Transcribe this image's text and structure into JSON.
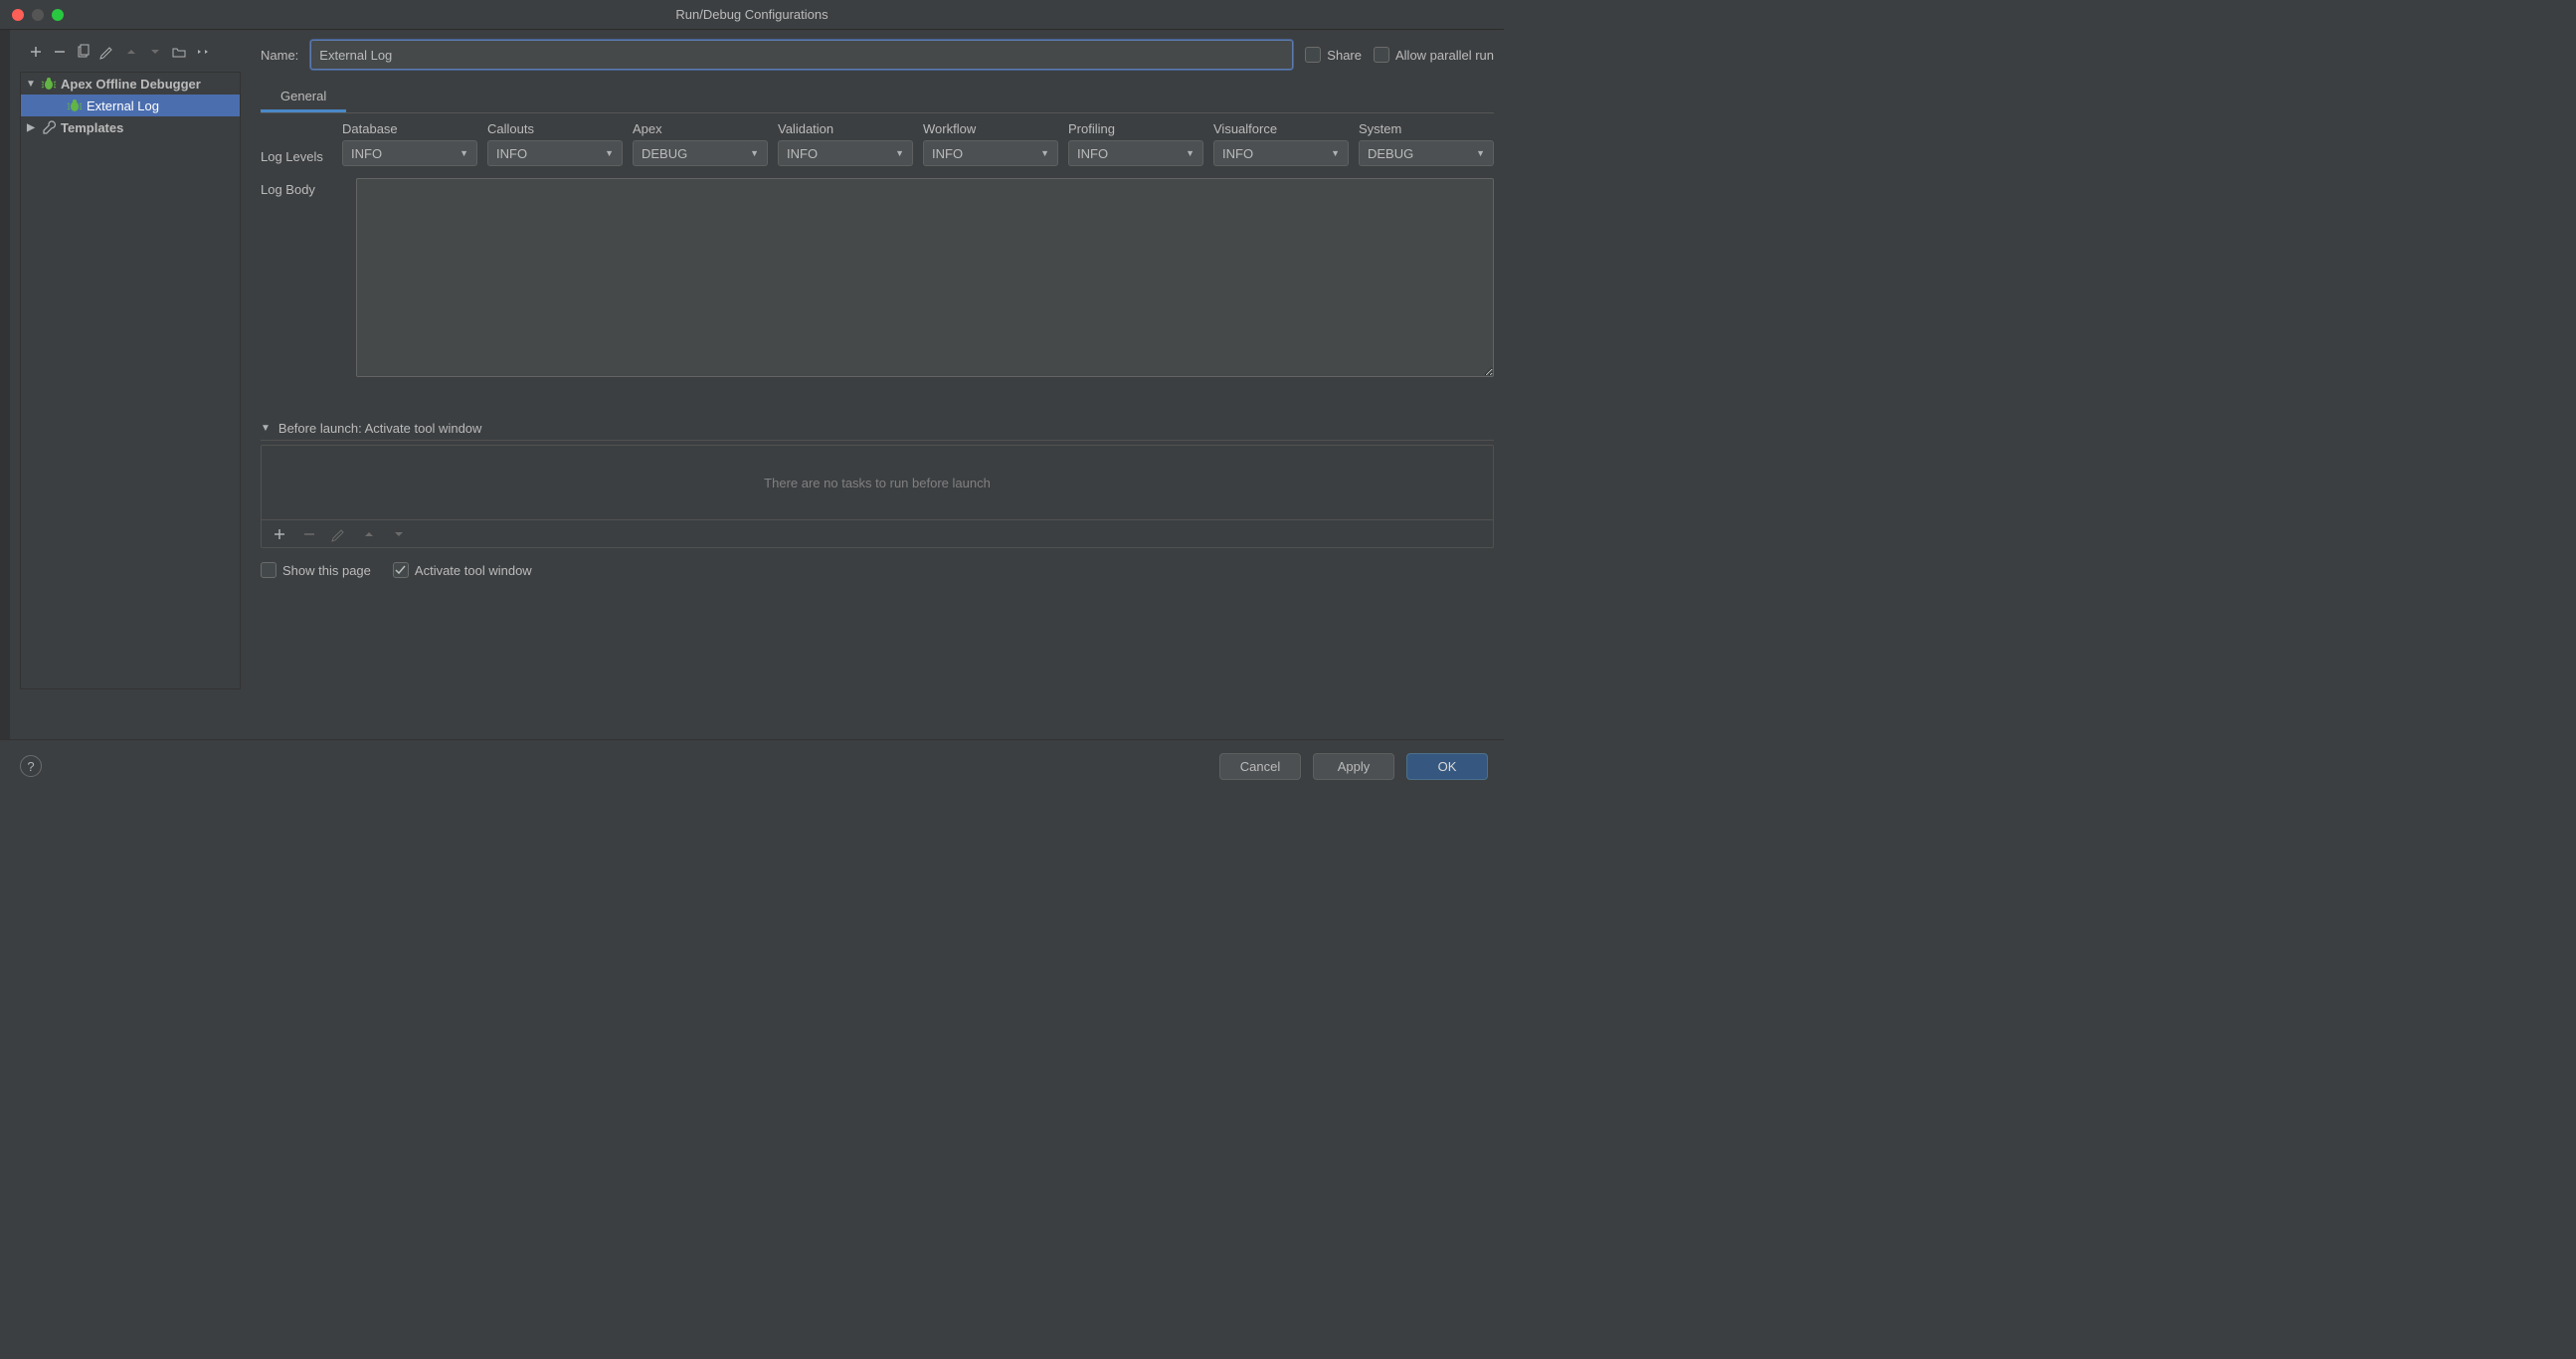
{
  "window": {
    "title": "Run/Debug Configurations"
  },
  "sidebar": {
    "items": [
      {
        "label": "Apex Offline Debugger",
        "expanded": true,
        "kind": "debugger"
      },
      {
        "label": "External Log",
        "kind": "log",
        "selected": true
      },
      {
        "label": "Templates",
        "expanded": false,
        "kind": "templates"
      }
    ]
  },
  "form": {
    "name_label": "Name:",
    "name_value": "External Log",
    "share_label": "Share",
    "share_checked": false,
    "allow_parallel_label": "Allow parallel run",
    "allow_parallel_checked": false
  },
  "tabs": [
    {
      "label": "General",
      "active": true
    }
  ],
  "log_levels": {
    "row_label": "Log Levels",
    "columns": [
      {
        "header": "Database",
        "value": "INFO"
      },
      {
        "header": "Callouts",
        "value": "INFO"
      },
      {
        "header": "Apex",
        "value": "DEBUG"
      },
      {
        "header": "Validation",
        "value": "INFO"
      },
      {
        "header": "Workflow",
        "value": "INFO"
      },
      {
        "header": "Profiling",
        "value": "INFO"
      },
      {
        "header": "Visualforce",
        "value": "INFO"
      },
      {
        "header": "System",
        "value": "DEBUG"
      }
    ]
  },
  "log_body": {
    "label": "Log Body",
    "value": ""
  },
  "before_launch": {
    "header": "Before launch: Activate tool window",
    "empty_text": "There are no tasks to run before launch"
  },
  "checks": {
    "show_this_page_label": "Show this page",
    "show_this_page_checked": false,
    "activate_tool_label": "Activate tool window",
    "activate_tool_checked": true
  },
  "buttons": {
    "cancel": "Cancel",
    "apply": "Apply",
    "ok": "OK",
    "help": "?"
  }
}
